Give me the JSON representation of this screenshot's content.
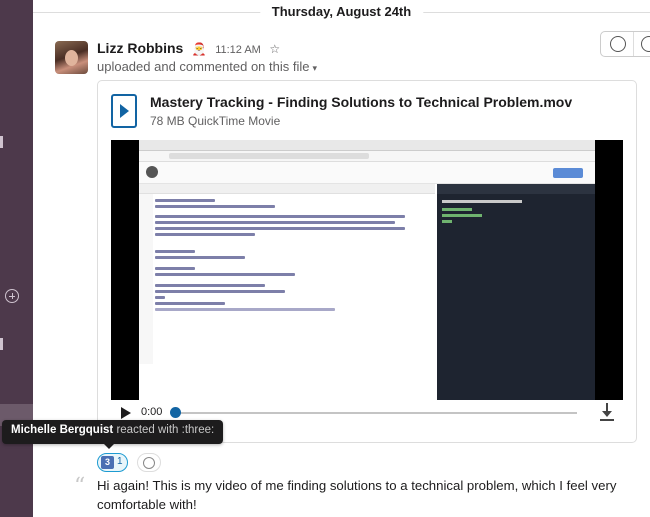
{
  "day_divider": "Thursday, August 24th",
  "message": {
    "author": "Lizz Robbins",
    "status_emoji": "santa-hat",
    "time": "11:12 AM",
    "star_icon": "star-outline-icon",
    "subline": "uploaded and commented on this file",
    "subline_caret": "▾"
  },
  "file": {
    "title": "Mastery Tracking - Finding Solutions to Technical Problem.mov",
    "meta": "78 MB QuickTime Movie",
    "icon": "video-file-icon"
  },
  "video": {
    "time": "0:00",
    "progress_fraction": 0.0
  },
  "tooltip": {
    "name": "Michelle Bergquist",
    "rest": " reacted with :three:"
  },
  "reaction": {
    "emoji_label": "3",
    "count": "1"
  },
  "comment": "Hi again! This is my video of me finding solutions to a technical problem, which I feel very comfortable with!",
  "quote_mark": "“",
  "colors": {
    "sidebar": "#4d394b",
    "link_blue": "#1264a3",
    "reaction_border": "#1d9bd1"
  }
}
